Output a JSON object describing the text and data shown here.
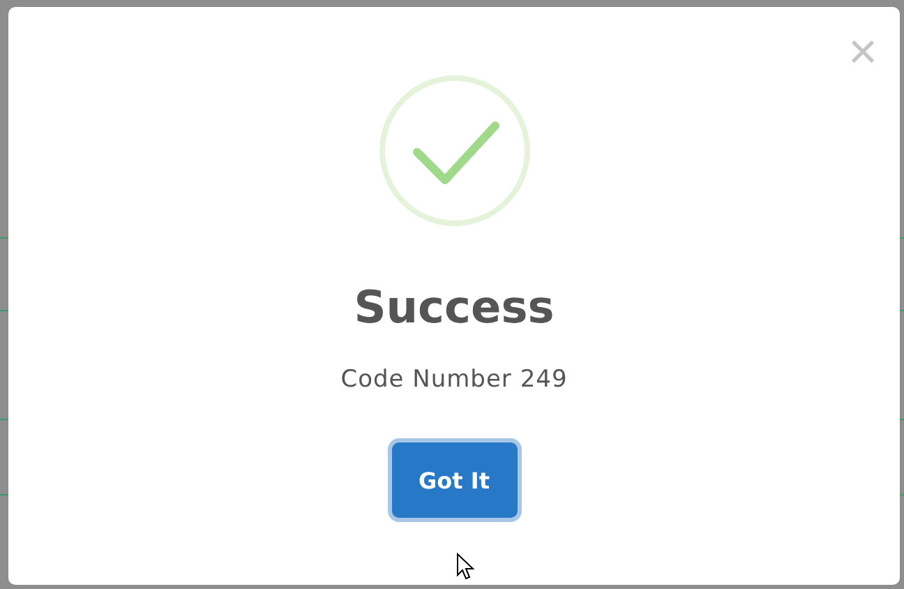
{
  "dialog": {
    "title": "Success",
    "message": "Code Number 249",
    "button": "Got It",
    "close": "×"
  }
}
